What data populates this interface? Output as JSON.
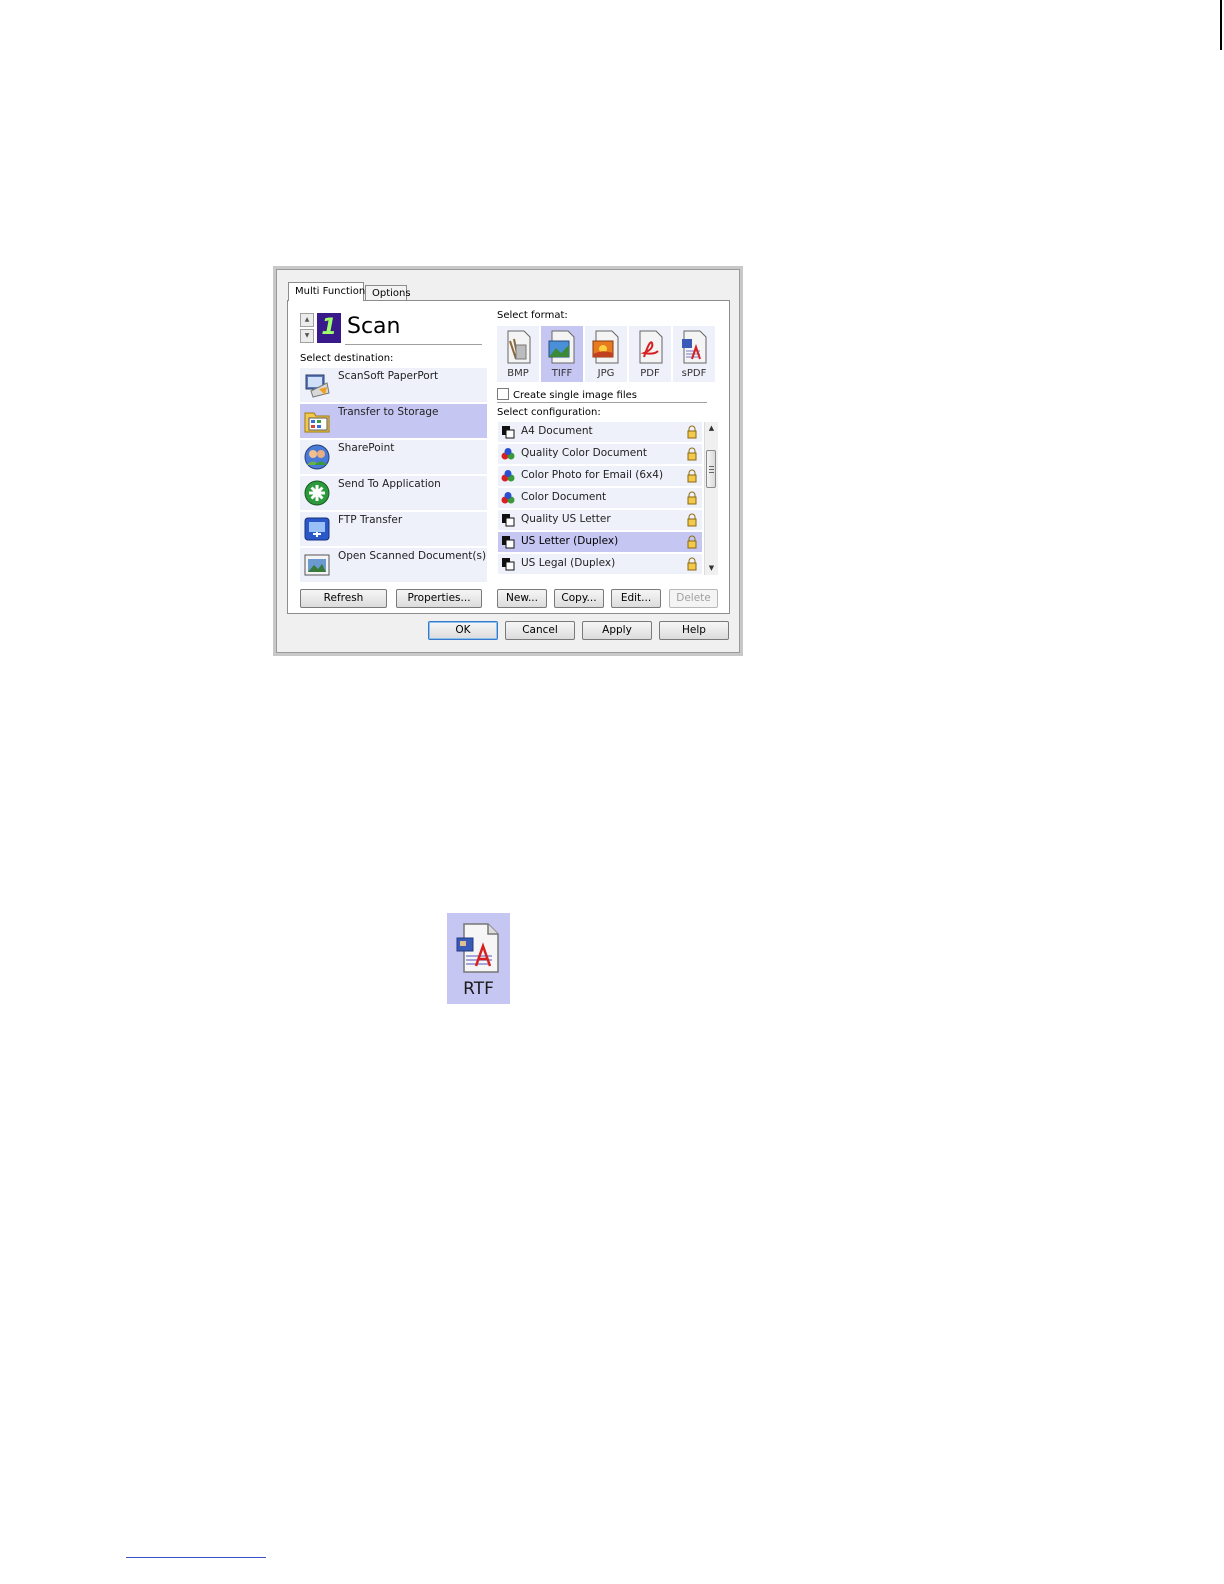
{
  "tabs": [
    "Multi Function",
    "Options"
  ],
  "scan": {
    "number": "1",
    "title": "Scan"
  },
  "labels": {
    "select_destination": "Select destination:",
    "select_format": "Select format:",
    "select_configuration": "Select configuration:",
    "create_single": "Create single image files"
  },
  "destinations": [
    {
      "label": "ScanSoft PaperPort",
      "icon": "paperport-icon",
      "selected": false
    },
    {
      "label": "Transfer to Storage",
      "icon": "folder-storage-icon",
      "selected": true
    },
    {
      "label": "SharePoint",
      "icon": "sharepoint-icon",
      "selected": false
    },
    {
      "label": "Send To Application",
      "icon": "application-icon",
      "selected": false
    },
    {
      "label": "FTP Transfer",
      "icon": "ftp-icon",
      "selected": false
    },
    {
      "label": "Open Scanned Document(s)",
      "icon": "open-document-icon",
      "selected": false
    }
  ],
  "formats": [
    {
      "label": "BMP",
      "selected": false
    },
    {
      "label": "TIFF",
      "selected": true
    },
    {
      "label": "JPG",
      "selected": false
    },
    {
      "label": "PDF",
      "selected": false
    },
    {
      "label": "sPDF",
      "selected": false
    }
  ],
  "configurations": [
    {
      "label": "A4 Document",
      "icon": "bw-document-icon",
      "selected": false
    },
    {
      "label": "Quality Color Document",
      "icon": "color-document-icon",
      "selected": false
    },
    {
      "label": "Color Photo for Email (6x4)",
      "icon": "color-document-icon",
      "selected": false
    },
    {
      "label": "Color Document",
      "icon": "color-document-icon",
      "selected": false
    },
    {
      "label": "Quality US Letter",
      "icon": "bw-document-icon",
      "selected": false
    },
    {
      "label": "US Letter (Duplex)",
      "icon": "bw-document-icon",
      "selected": true
    },
    {
      "label": "US Legal (Duplex)",
      "icon": "bw-document-icon",
      "selected": false
    }
  ],
  "buttons": {
    "refresh": "Refresh",
    "properties": "Properties...",
    "new": "New...",
    "copy": "Copy...",
    "edit": "Edit...",
    "delete": "Delete",
    "ok": "OK",
    "cancel": "Cancel",
    "apply": "Apply",
    "help": "Help"
  },
  "rtf": {
    "label": "RTF"
  },
  "colors": {
    "selected": "#c6c6f2",
    "item": "#eef0fa",
    "accent": "#3a1a8a"
  }
}
